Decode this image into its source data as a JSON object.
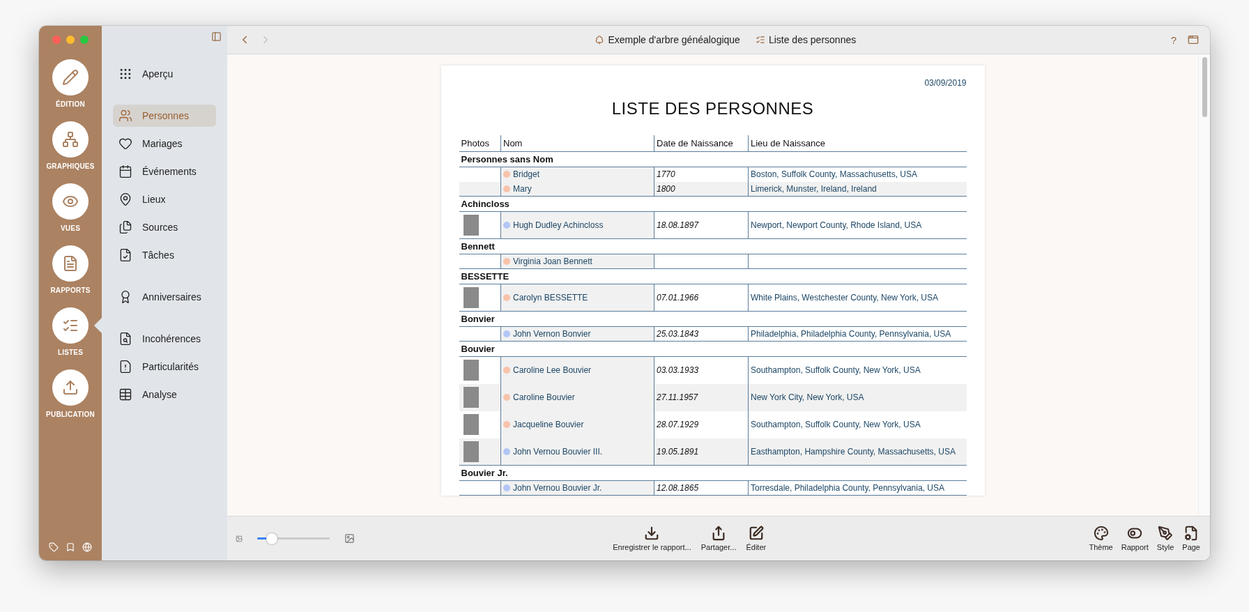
{
  "rail": {
    "items": [
      {
        "label": "ÉDITION",
        "selected": false
      },
      {
        "label": "GRAPHIQUES",
        "selected": false
      },
      {
        "label": "VUES",
        "selected": false
      },
      {
        "label": "RAPPORTS",
        "selected": false
      },
      {
        "label": "LISTES",
        "selected": true
      },
      {
        "label": "PUBLICATION",
        "selected": false
      }
    ]
  },
  "sidebar": {
    "sections": [
      {
        "items": [
          {
            "label": "Aperçu",
            "selected": false
          }
        ]
      },
      {
        "items": [
          {
            "label": "Personnes",
            "selected": true
          },
          {
            "label": "Mariages",
            "selected": false
          },
          {
            "label": "Événements",
            "selected": false
          },
          {
            "label": "Lieux",
            "selected": false
          },
          {
            "label": "Sources",
            "selected": false
          },
          {
            "label": "Tâches",
            "selected": false
          }
        ]
      },
      {
        "items": [
          {
            "label": "Anniversaires",
            "selected": false
          }
        ]
      },
      {
        "items": [
          {
            "label": "Incohérences",
            "selected": false
          },
          {
            "label": "Particularités",
            "selected": false
          },
          {
            "label": "Analyse",
            "selected": false
          }
        ]
      }
    ]
  },
  "toolbar": {
    "back_disabled": false,
    "forward_disabled": true,
    "breadcrumbs": [
      "Exemple d'arbre généalogique",
      "Liste des personnes"
    ],
    "help": "?"
  },
  "report": {
    "date": "03/09/2019",
    "title": "LISTE DES PERSONNES",
    "columns": [
      "Photos",
      "Nom",
      "Date de Naissance",
      "Lieu de Naissance"
    ],
    "groups": [
      {
        "name": "Personnes sans Nom",
        "persons": [
          {
            "photo": false,
            "color": "#f8c3ab",
            "name": "Bridget",
            "date": "1770",
            "place": "Boston, Suffolk County, Massachusetts, USA"
          },
          {
            "photo": false,
            "color": "#f8c3ab",
            "name": "Mary",
            "date": "1800",
            "place": "Limerick, Munster, Ireland, Ireland"
          }
        ]
      },
      {
        "name": "Achincloss",
        "persons": [
          {
            "photo": true,
            "color": "#b3c6f6",
            "name": "Hugh Dudley Achincloss",
            "date": "18.08.1897",
            "place": "Newport, Newport County, Rhode Island, USA"
          }
        ]
      },
      {
        "name": "Bennett",
        "persons": [
          {
            "photo": false,
            "color": "#f8c3ab",
            "name": "Virginia Joan Bennett"
          }
        ]
      },
      {
        "name": "BESSETTE",
        "persons": [
          {
            "photo": true,
            "color": "#f8c3ab",
            "name": "Carolyn BESSETTE",
            "date": "07.01.1966",
            "place": "White Plains, Westchester County, New York, USA"
          }
        ]
      },
      {
        "name": "Bonvier",
        "persons": [
          {
            "photo": false,
            "color": "#b3c6f6",
            "name": "John Vernon Bonvier",
            "date": "25.03.1843",
            "place": "Philadelphia, Philadelphia County, Pennsylvania, USA"
          }
        ]
      },
      {
        "name": "Bouvier",
        "persons": [
          {
            "photo": true,
            "color": "#f8c3ab",
            "name": "Caroline Lee Bouvier",
            "date": "03.03.1933",
            "place": "Southampton, Suffolk County, New York, USA"
          },
          {
            "photo": true,
            "color": "#f8c3ab",
            "name": "Caroline Bouvier",
            "date": "27.11.1957",
            "place": "New York City, New York, USA"
          },
          {
            "photo": true,
            "color": "#f8c3ab",
            "name": "Jacqueline Bouvier",
            "date": "28.07.1929",
            "place": "Southampton, Suffolk County, New York, USA"
          },
          {
            "photo": true,
            "color": "#b3c6f6",
            "name": "John Vernou Bouvier III.",
            "date": "19.05.1891",
            "place": "Easthampton, Hampshire County, Massachusetts, USA"
          }
        ]
      },
      {
        "name": "Bouvier Jr.",
        "persons": [
          {
            "photo": false,
            "color": "#b3c6f6",
            "name": "John Vernou Bouvier Jr.",
            "date": "12.08.1865",
            "place": "Torresdale, Philadelphia County, Pennsylvania, USA"
          }
        ]
      }
    ]
  },
  "bottom_bar": {
    "zoom": {
      "level": 0.2
    },
    "center_actions": [
      "Enregistrer le rapport...",
      "Partager...",
      "Éditer"
    ],
    "right_actions": [
      "Thème",
      "Rapport",
      "Style",
      "Page"
    ]
  }
}
